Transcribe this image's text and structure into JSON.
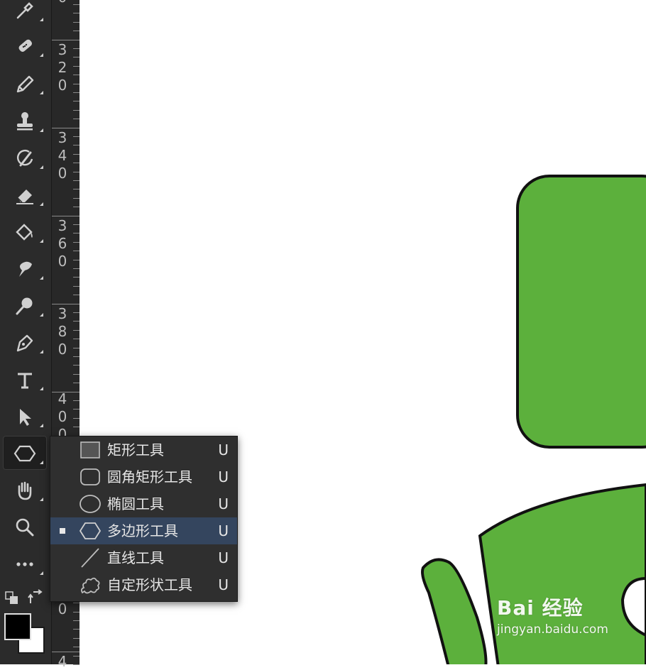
{
  "toolbar": {
    "tools": [
      {
        "icon": "eyedropper-icon"
      },
      {
        "icon": "healing-brush-icon"
      },
      {
        "icon": "pencil-icon"
      },
      {
        "icon": "clone-stamp-icon"
      },
      {
        "icon": "history-brush-icon"
      },
      {
        "icon": "eraser-icon"
      },
      {
        "icon": "paint-bucket-icon"
      },
      {
        "icon": "smudge-icon"
      },
      {
        "icon": "dodge-icon"
      },
      {
        "icon": "pen-icon"
      },
      {
        "icon": "text-icon",
        "glyph": "T"
      },
      {
        "icon": "path-selection-icon"
      },
      {
        "icon": "polygon-tool-icon",
        "active": true
      },
      {
        "icon": "hand-icon"
      },
      {
        "icon": "zoom-icon"
      },
      {
        "icon": "more-tools-icon",
        "glyph": "•••"
      }
    ],
    "foreground_color": "#000000",
    "background_color": "#ffffff"
  },
  "ruler": {
    "labels": [
      {
        "digits": [
          "3",
          "2",
          "0"
        ]
      },
      {
        "digits": [
          "3",
          "4",
          "0"
        ]
      },
      {
        "digits": [
          "3",
          "6",
          "0"
        ]
      },
      {
        "digits": [
          "3",
          "8",
          "0"
        ]
      },
      {
        "digits": [
          "4",
          "0",
          "0"
        ]
      }
    ],
    "fragments": [
      "0",
      "0",
      "4"
    ]
  },
  "shape_menu": {
    "items": [
      {
        "label": "矩形工具",
        "shortcut": "U",
        "icon": "rectangle-icon"
      },
      {
        "label": "圆角矩形工具",
        "shortcut": "U",
        "icon": "rounded-rectangle-icon"
      },
      {
        "label": "椭圆工具",
        "shortcut": "U",
        "icon": "ellipse-icon"
      },
      {
        "label": "多边形工具",
        "shortcut": "U",
        "icon": "polygon-icon",
        "selected": true
      },
      {
        "label": "直线工具",
        "shortcut": "U",
        "icon": "line-icon"
      },
      {
        "label": "自定形状工具",
        "shortcut": "U",
        "icon": "custom-shape-icon"
      }
    ]
  },
  "canvas": {
    "shape_fill": "#5cb03c",
    "shape_stroke": "#111111"
  },
  "watermark": {
    "text": "Bai 经验",
    "url": "jingyan.baidu.com"
  }
}
